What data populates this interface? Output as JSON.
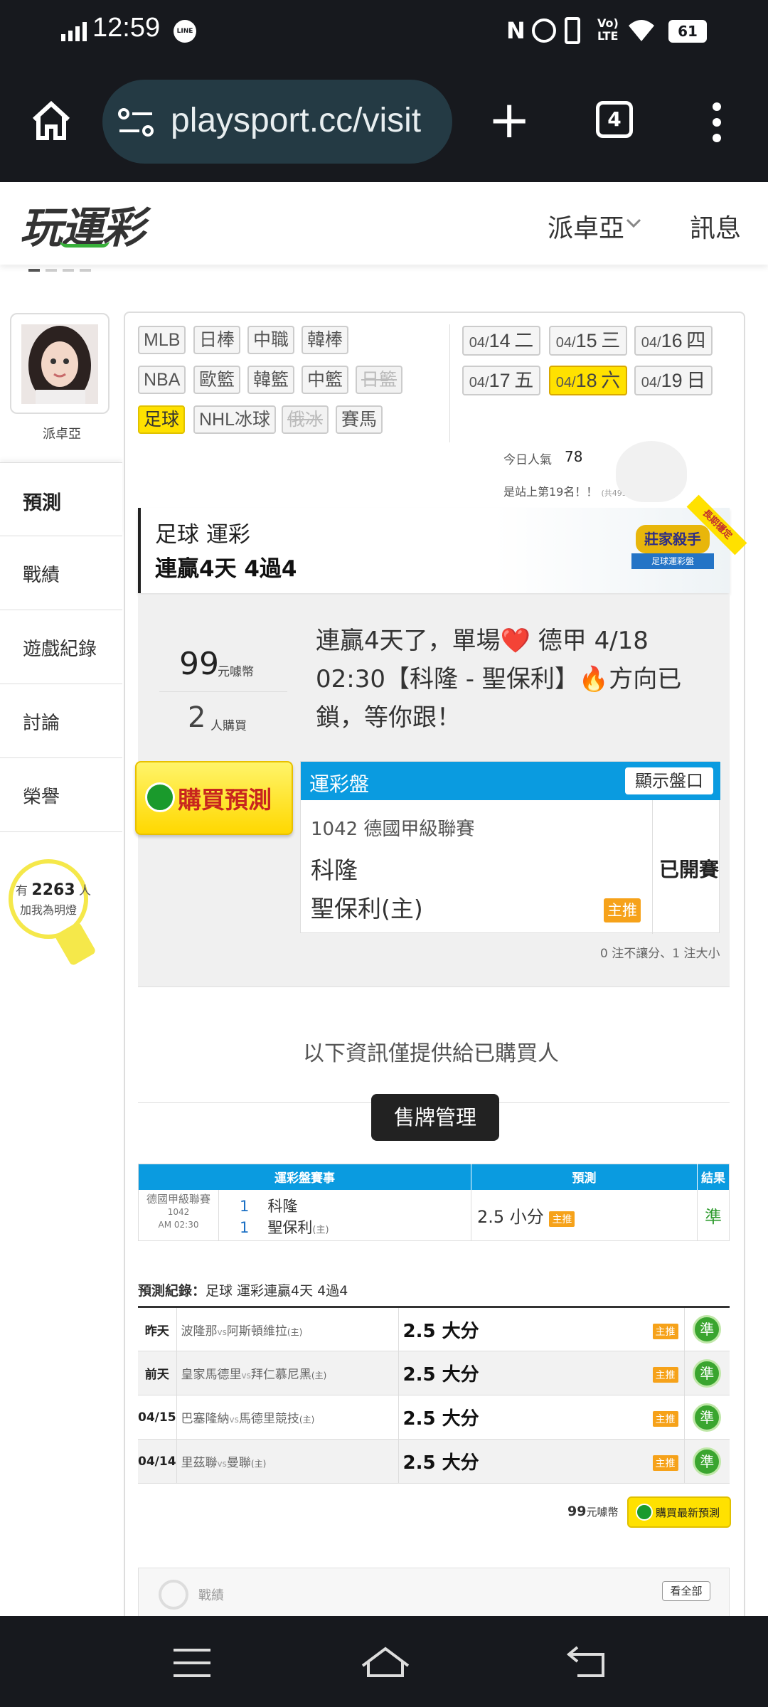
{
  "status_bar": {
    "time": "12:59",
    "battery": "61"
  },
  "browser": {
    "url": "playsport.cc/visit",
    "tab_count": "4"
  },
  "site": {
    "logo": "玩運彩",
    "user_menu": "派卓亞",
    "messages": "訊息"
  },
  "profile": {
    "name": "派卓亞",
    "fans_prefix": "有",
    "fans_count": "2263",
    "fans_suffix": "人",
    "fans_note": "加我為明燈"
  },
  "sidebar": {
    "items": [
      {
        "label": "預測"
      },
      {
        "label": "戰績"
      },
      {
        "label": "遊戲紀錄"
      },
      {
        "label": "討論"
      },
      {
        "label": "榮譽"
      }
    ]
  },
  "leagues": {
    "row1": [
      "MLB",
      "日棒",
      "中職",
      "韓棒"
    ],
    "row2": [
      "NBA",
      "歐籃",
      "韓籃",
      "中籃",
      "日籃"
    ],
    "row3": [
      "足球",
      "NHL冰球",
      "俄冰",
      "賽馬"
    ]
  },
  "dates": [
    {
      "md": "04/",
      "d": "14",
      "w": "二"
    },
    {
      "md": "04/",
      "d": "15",
      "w": "三"
    },
    {
      "md": "04/",
      "d": "16",
      "w": "四"
    },
    {
      "md": "04/",
      "d": "17",
      "w": "五"
    },
    {
      "md": "04/",
      "d": "18",
      "w": "六"
    },
    {
      "md": "04/",
      "d": "19",
      "w": "日"
    }
  ],
  "popularity": {
    "label": "今日人氣",
    "value": "78",
    "rank_text": "是站上第19名！！",
    "rank_note": "(共4934人)"
  },
  "banner": {
    "title": "足球 運彩",
    "subtitle": "連贏4天 4過4",
    "badge": "莊家殺手",
    "badge_sub": "足球運彩盤",
    "ribbon": "長期穩定"
  },
  "prediction": {
    "price": "99",
    "price_unit": "元噱幣",
    "buyers": "2",
    "buyers_unit": "人購買",
    "message": "連贏4天了，單場❤️ 德甲 4/18 02:30【科隆 - 聖保利】🔥方向已鎖，等你跟！",
    "buy_button": "購買預測",
    "panel_title": "運彩盤",
    "show_odds": "顯示盤口",
    "match_line": "1042 德國甲級聯賽",
    "team_away": "科隆",
    "team_home": "聖保利(主)",
    "main_tag": "主推",
    "status": "已開賽",
    "note": "0 注不讓分、1 注大小"
  },
  "buyer_info": {
    "label": "以下資訊僅提供給已購買人",
    "button": "售牌管理"
  },
  "result_table": {
    "headers": [
      "運彩盤賽事",
      "預測",
      "結果"
    ],
    "league": "德國甲級聯賽",
    "code": "1042",
    "time": "AM 02:30",
    "n1": "1",
    "t1": "科隆",
    "n2": "1",
    "t2": "聖保利",
    "t2_note": "(主)",
    "pick": "2.5 小分",
    "pick_tag": "主推",
    "result": "準"
  },
  "history": {
    "title_prefix": "預測紀錄：",
    "title": "足球 運彩連贏4天 4過4",
    "rows": [
      {
        "day": "昨天",
        "home": "波隆那",
        "vs": "vs",
        "away": "阿斯頓維拉",
        "away_note": "(主)",
        "pick": "2.5 大分",
        "tag": "主推",
        "result": "準"
      },
      {
        "day": "前天",
        "home": "皇家馬德里",
        "vs": "vs",
        "away": "拜仁慕尼黑",
        "away_note": "(主)",
        "pick": "2.5 大分",
        "tag": "主推",
        "result": "準"
      },
      {
        "day": "04/15",
        "home": "巴塞隆納",
        "vs": "vs",
        "away": "馬德里競技",
        "away_note": "(主)",
        "pick": "2.5 大分",
        "tag": "主推",
        "result": "準"
      },
      {
        "day": "04/14",
        "home": "里茲聯",
        "vs": "vs",
        "away": "曼聯",
        "away_note": "(主)",
        "pick": "2.5 大分",
        "tag": "主推",
        "result": "準"
      }
    ]
  },
  "footer_buy": {
    "price": "99",
    "unit": "元噱幣",
    "button": "購買最新預測"
  },
  "record_section": {
    "title": "戰績",
    "view_all": "看全部"
  },
  "colors": {
    "accent_blue": "#0a9be0",
    "highlight_yellow": "#ffe100",
    "win_green": "#3aa52f",
    "tag_orange": "#f6a21a"
  }
}
